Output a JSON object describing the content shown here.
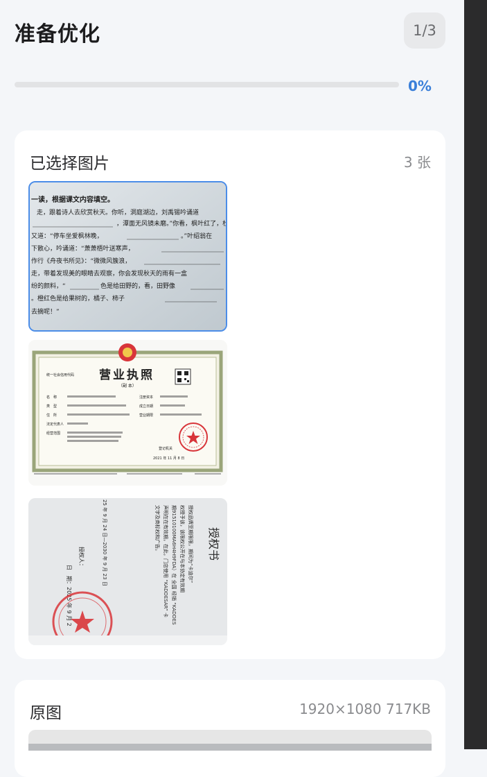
{
  "header": {
    "title": "准备优化",
    "step": "1/3"
  },
  "progress": {
    "percent_label": "0%",
    "value": 0
  },
  "selected_images": {
    "title": "已选择图片",
    "count_label": "3 张",
    "items": [
      {
        "kind": "textbook-page",
        "lines": [
          "一读，根据课文内容填空。",
          "走，跟着诗人去欣赏秋天。你听，洞庭湖边，刘禹锡吟诵道",
          "，潭面无风镜未磨。”你看，枫叶红了，杜牧",
          "又道：“停车坐爱枫林晚，",
          "。”叶绍翁在",
          "下散心，吟诵道：“萧萧梧叶送寒声，",
          "作行《舟夜书所见》：“微微风簇浪，",
          "走，带着发现美的眼睛去观察，你会发现秋天的雨有一盒",
          "纷的颜料，“",
          "色是给田野的，看，田野像",
          "。橙红色是给果树的，橘子、柿子",
          "去摘呢！”"
        ]
      },
      {
        "kind": "business-license",
        "code_label": "统一社会信用代码",
        "heading": "营业执照",
        "subheading": "（副 本）",
        "fields": [
          "名　称",
          "类　型",
          "住　所",
          "法定代表人",
          "经营范围"
        ],
        "right_fields": [
          "注册资本",
          "成立日期",
          "营业期限"
        ],
        "issuer": "登记机关",
        "date_label": "2021 年 11 月 8 日"
      },
      {
        "kind": "authorization-letter",
        "heading": "授权书",
        "columns": [
          "授权品牌至期限限，期间为“卡迪尔”",
          "权授予该，该限权公开在与本协定有效期",
          "期91510100MA6H4H9FDA）在 全国 经销 “KADDES",
          "声明在在有效期，在此，门店使用 “KADDESAR” 卡",
          "文字及商标权和广告。",
          "25 年 9 月 24 日—2030 年 9 月 23 日",
          "授权人：",
          "日　期：2025 年 9 月 2"
        ]
      }
    ]
  },
  "original_image": {
    "title": "原图",
    "info": "1920×1080 717KB"
  },
  "colors": {
    "accent": "#3d7ee6",
    "selected_border": "#4b8de8",
    "background": "#f4f6f9",
    "card": "#ffffff",
    "stamp_red": "#d8353a"
  }
}
